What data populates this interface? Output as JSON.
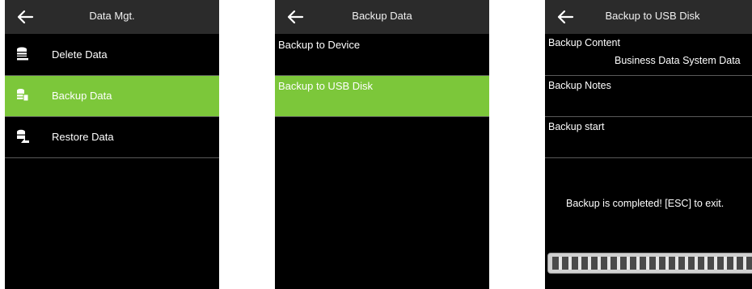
{
  "screen1": {
    "title": "Data Mgt.",
    "items": [
      {
        "label": "Delete Data",
        "icon": "delete-data-icon"
      },
      {
        "label": "Backup Data",
        "icon": "backup-data-icon",
        "selected": true
      },
      {
        "label": "Restore Data",
        "icon": "restore-data-icon"
      }
    ]
  },
  "screen2": {
    "title": "Backup Data",
    "items": [
      {
        "label": "Backup to Device"
      },
      {
        "label": "Backup to USB Disk",
        "selected": true
      }
    ]
  },
  "screen3": {
    "title": "Backup to USB Disk",
    "backup_content_label": "Backup Content",
    "backup_content_value": "Business Data System Data",
    "backup_notes_label": "Backup Notes",
    "backup_start_label": "Backup start",
    "status_message": "Backup is completed! [ESC] to exit.",
    "progress_fraction": 1.0
  },
  "colors": {
    "accent": "#7cc73a",
    "background": "#000000",
    "title_bar": "#2b2b2b",
    "text": "#ffffff"
  }
}
